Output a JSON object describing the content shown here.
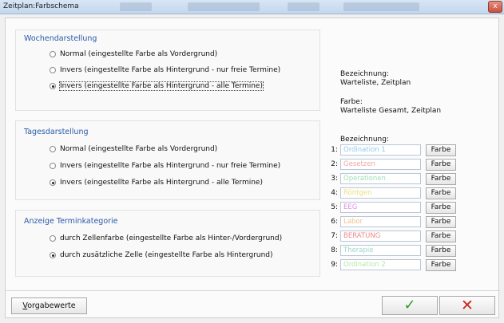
{
  "window": {
    "title": "Zeitplan:Farbschema",
    "close_glyph": "x"
  },
  "wochen": {
    "title": "Wochendarstellung",
    "options": [
      "Normal (eingestellte Farbe als Vordergrund)",
      "Invers (eingestellte Farbe als Hintergrund - nur freie Termine)",
      "Invers (eingestellte Farbe als Hintergrund - alle Termine)"
    ],
    "selected_index": 2
  },
  "tages": {
    "title": "Tagesdarstellung",
    "options": [
      "Normal (eingestellte Farbe als Vordergrund)",
      "Invers (eingestellte Farbe als Hintergrund - nur freie Termine)",
      "Invers (eingestellte Farbe als Hintergrund - alle Termine)"
    ],
    "selected_index": 2
  },
  "kategorie": {
    "title": "Anzeige Terminkategorie",
    "options": [
      "durch Zellenfarbe (eingestellte Farbe als Hinter-/Vordergrund)",
      "durch zusätzliche Zelle (eingestellte Farbe als Hintergrund)"
    ],
    "selected_index": 1
  },
  "info": {
    "bezeichnung_label": "Bezeichnung:",
    "bezeichnung_value": "Warteliste, Zeitplan",
    "farbe_label": "Farbe:",
    "farbe_value": "Warteliste Gesamt, Zeitplan"
  },
  "categories_label": "Bezeichnung:",
  "categories": [
    {
      "num": "1:",
      "name": "Ordination 1",
      "color": "#8fc8f0",
      "button": "Farbe"
    },
    {
      "num": "2:",
      "name": "Gesetzen",
      "color": "#f2a6a6",
      "button": "Farbe"
    },
    {
      "num": "3:",
      "name": "Operationen",
      "color": "#9ee0b6",
      "button": "Farbe"
    },
    {
      "num": "4:",
      "name": "Röntgen",
      "color": "#e8e07a",
      "button": "Farbe"
    },
    {
      "num": "5:",
      "name": "EEG",
      "color": "#e88ae8",
      "button": "Farbe"
    },
    {
      "num": "6:",
      "name": "Labor",
      "color": "#f0c08a",
      "button": "Farbe"
    },
    {
      "num": "7:",
      "name": "BERATUNG",
      "color": "#f08a8a",
      "button": "Farbe"
    },
    {
      "num": "8:",
      "name": "Therapie",
      "color": "#9ad6c8",
      "button": "Farbe"
    },
    {
      "num": "9:",
      "name": "Ordination 2",
      "color": "#b6e8a8",
      "button": "Farbe"
    }
  ],
  "footer": {
    "defaults_button": "Vorgabewerte",
    "defaults_hotkey": "V",
    "defaults_rest": "orgabewerte",
    "ok_glyph": "✓",
    "cancel_glyph": "✕"
  },
  "colors": {
    "group_title": "#2a5aa8",
    "ok": "#2e9a2e",
    "cancel": "#c8281e"
  }
}
